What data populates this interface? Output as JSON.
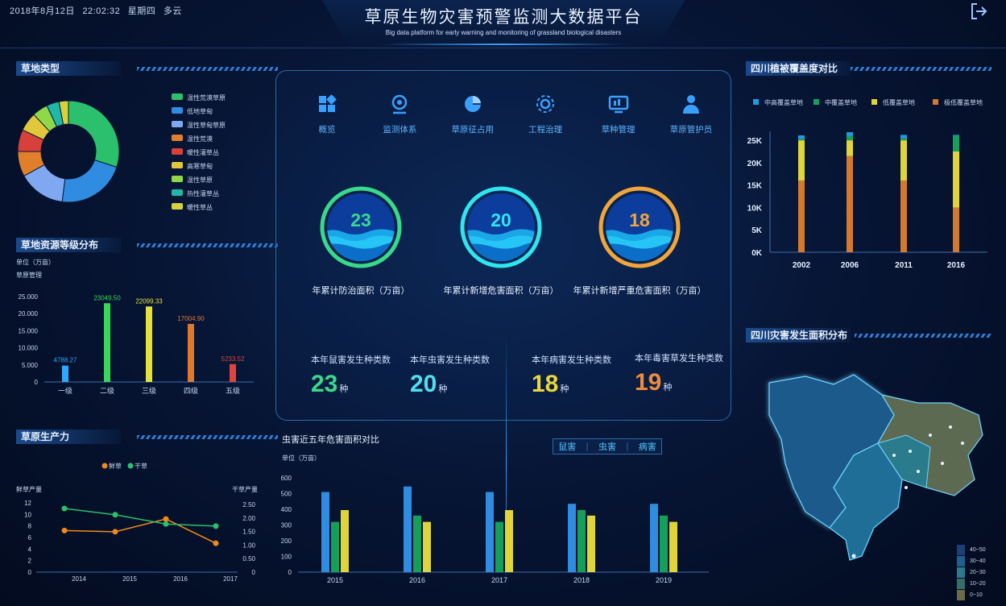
{
  "header": {
    "date": "2018年8月12日",
    "time": "22:02:32",
    "weekday": "星期四",
    "weather": "多云",
    "title": "草原生物灾害预警监测大数据平台",
    "subtitle": "Big data platform for early warning and monitoring of grassland biological disasters",
    "exit_icon": "exit-icon"
  },
  "sections": {
    "grass_type": "草地类型",
    "grade": "草地资源等级分布",
    "productivity": "草原生产力",
    "coverage": "四川植被覆盖度对比",
    "disaster_map": "四川灾害发生面积分布",
    "pest_chart": "虫害近五年危害面积对比"
  },
  "nav": [
    {
      "label": "概览",
      "icon": "grid-icon"
    },
    {
      "label": "监测体系",
      "icon": "camera-icon"
    },
    {
      "label": "草原征占用",
      "icon": "pie-icon"
    },
    {
      "label": "工程治理",
      "icon": "gear-icon"
    },
    {
      "label": "草种管理",
      "icon": "monitor-icon"
    },
    {
      "label": "草原管护员",
      "icon": "person-icon"
    }
  ],
  "rings": [
    {
      "value": "23",
      "label": "年累计防治面积（万亩）",
      "color": "#39d98a"
    },
    {
      "value": "20",
      "label": "年累计新增危害面积（万亩）",
      "color": "#2ee6f0"
    },
    {
      "value": "18",
      "label": "年累计新增严重危害面积（万亩）",
      "color": "#f0a63c"
    }
  ],
  "stats": [
    {
      "label": "本年鼠害发生种类数",
      "value": "23",
      "unit": "种",
      "color": "#39d98a"
    },
    {
      "label": "本年虫害发生种类数",
      "value": "20",
      "unit": "种",
      "color": "#4fe0f0"
    },
    {
      "label": "本年病害发生种类数",
      "value": "18",
      "unit": "种",
      "color": "#e8d63a"
    },
    {
      "label": "本年毒害草发生种类数",
      "value": "19",
      "unit": "种",
      "color": "#f08a3c"
    }
  ],
  "tabs": [
    "鼠害",
    "虫害",
    "病害"
  ],
  "map_legend": [
    "40~50",
    "30~40",
    "20~30",
    "10~20",
    "0~10"
  ],
  "map_legend_colors": [
    "#1c3f7a",
    "#1f5f8e",
    "#2a7b8c",
    "#356e6a",
    "#6d6a48"
  ],
  "chart_data": [
    {
      "id": "grass_type",
      "type": "pie",
      "donut": true,
      "categories": [
        "温性荒漠草原",
        "低地草甸",
        "温性草甸草原",
        "温性荒漠",
        "暖性灌草丛",
        "高寒草甸",
        "温性草原",
        "热性灌草丛",
        "暖性草丛"
      ],
      "values": [
        30,
        22,
        15,
        8,
        7,
        6,
        5,
        4,
        3
      ],
      "colors": [
        "#2bc06b",
        "#2f8ce0",
        "#7fa8f0",
        "#e07f2a",
        "#d8403a",
        "#e0c83a",
        "#8fd84a",
        "#1fb8a8",
        "#d8d23a"
      ],
      "legend": "right"
    },
    {
      "id": "grade",
      "type": "bar",
      "unit": "单位（万亩）",
      "ylabel": "草原管理",
      "categories": [
        "一级",
        "二级",
        "三级",
        "四级",
        "五级"
      ],
      "values": [
        4788.27,
        23049.5,
        22099.33,
        17004.9,
        5233.52
      ],
      "value_labels": [
        "4788.27",
        "23049.50",
        "22099.33",
        "17004.90",
        "5233.52"
      ],
      "colors": [
        "#2fa8ff",
        "#39d65a",
        "#e6e03a",
        "#e0782a",
        "#e0443a"
      ],
      "yticks": [
        "25.000",
        "20.000",
        "15.000",
        "10.000",
        "5.000",
        "0"
      ],
      "ylim": [
        0,
        25000
      ]
    },
    {
      "id": "productivity",
      "type": "line",
      "x": [
        "2014",
        "2015",
        "2016",
        "2017"
      ],
      "series": [
        {
          "name": "鲜草",
          "values": [
            7.2,
            7.0,
            9.2,
            5.0
          ],
          "axis": "left",
          "color": "#f08a1c"
        },
        {
          "name": "干草",
          "values": [
            2.35,
            2.12,
            1.78,
            1.7
          ],
          "axis": "right",
          "color": "#2bc06b"
        }
      ],
      "ylabel_left": "鲜草产量",
      "ylabel_right": "干草产量",
      "yticks_left": [
        "12",
        "10",
        "8",
        "6",
        "4",
        "2",
        "0"
      ],
      "yticks_right": [
        "2.50",
        "2.00",
        "1.50",
        "1.00",
        "0.50",
        "0"
      ],
      "ylim_left": [
        0,
        12
      ],
      "ylim_right": [
        0,
        2.5
      ]
    },
    {
      "id": "coverage",
      "type": "bar",
      "stacked": true,
      "categories": [
        "2002",
        "2006",
        "2011",
        "2016"
      ],
      "series": [
        {
          "name": "极低覆盖草地",
          "values": [
            16000,
            21500,
            16000,
            10000
          ],
          "color": "#d47a2c"
        },
        {
          "name": "低覆盖草地",
          "values": [
            9000,
            3500,
            9000,
            12500
          ],
          "color": "#dfd43a"
        },
        {
          "name": "中覆盖草地",
          "values": [
            300,
            1000,
            400,
            3500
          ],
          "color": "#16a05a"
        },
        {
          "name": "中高覆盖草地",
          "values": [
            800,
            800,
            800,
            200
          ],
          "color": "#1f9ce0"
        }
      ],
      "legend_order": [
        "中高覆盖草地",
        "中覆盖草地",
        "低覆盖草地",
        "极低覆盖草地"
      ],
      "yticks": [
        "25K",
        "20K",
        "15K",
        "10K",
        "5K",
        "0K"
      ],
      "ylim": [
        0,
        27000
      ]
    },
    {
      "id": "pest",
      "type": "bar",
      "unit": "单位（万亩）",
      "categories": [
        "2015",
        "2016",
        "2017",
        "2018",
        "2019"
      ],
      "series": [
        {
          "name": "鼠害",
          "values": [
            510,
            545,
            510,
            435,
            435
          ],
          "color": "#2f8ce0"
        },
        {
          "name": "虫害",
          "values": [
            320,
            360,
            320,
            395,
            360
          ],
          "color": "#14a05a"
        },
        {
          "name": "病害",
          "values": [
            395,
            320,
            395,
            360,
            320
          ],
          "color": "#dfd43a"
        }
      ],
      "yticks": [
        "600",
        "500",
        "400",
        "300",
        "200",
        "100",
        "0"
      ],
      "ylim": [
        0,
        600
      ]
    }
  ]
}
